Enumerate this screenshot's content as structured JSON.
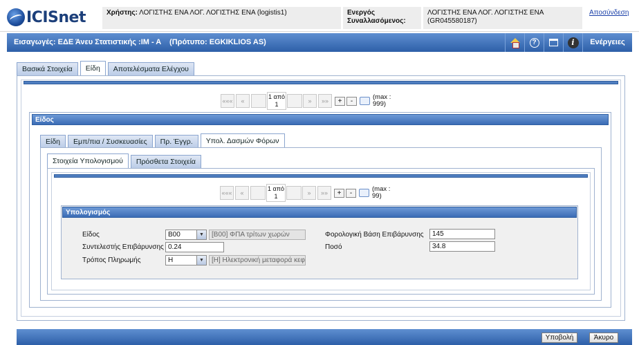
{
  "header": {
    "logo_text": "ICISnet",
    "user_label": "Χρήστης:",
    "user_value": "ΛΟΓΙΣΤΗΣ ΕΝΑ ΛΟΓ. ΛΟΓΙΣΤΗΣ ΕΝΑ (logistis1)",
    "active_label_line1": "Ενεργός",
    "active_label_line2": "Συναλλασόμενος:",
    "active_value_line1": "ΛΟΓΙΣΤΗΣ ΕΝΑ ΛΟΓ. ΛΟΓΙΣΤΗΣ ΕΝΑ",
    "active_value_line2": "(GR045580187)",
    "logout": "Αποσύνδεση"
  },
  "titlebar": {
    "title": "Εισαγωγές: ΕΔΕ Άνευ Στατιστικής :IM - A    (Πρότυπο: EGKIKLIOS AS)",
    "actions_label": "Ενέργειες",
    "icons": [
      "home-icon",
      "help-icon",
      "window-icon",
      "info-icon"
    ]
  },
  "main_tabs": [
    "Βασικά Στοιχεία",
    "Είδη",
    "Αποτελέσματα Ελέγχου"
  ],
  "pager_outer": {
    "first": "«««",
    "prev": "«",
    "count_line1": "1 από",
    "count_line2": "1",
    "next": "»",
    "last": "»»",
    "plus": "+",
    "minus": "-",
    "max_line1": "(max :",
    "max_line2": "999)"
  },
  "item_section": {
    "title": "Είδος",
    "tabs": [
      "Είδη",
      "Εμπ/πια / Συσκευασίες",
      "Πρ. Έγγρ.",
      "Υπολ. Δασμών Φόρων"
    ]
  },
  "calc_tabs": [
    "Στοιχεία Υπολογισμού",
    "Πρόσθετα Στοιχεία"
  ],
  "pager_inner": {
    "first": "«««",
    "prev": "«",
    "count_line1": "1 από",
    "count_line2": "1",
    "next": "»",
    "last": "»»",
    "plus": "+",
    "minus": "-",
    "max_line1": "(max :",
    "max_line2": "99)"
  },
  "calc": {
    "title": "Υπολογισμός",
    "eidos_label": "Είδος",
    "eidos_value": "B00",
    "eidos_desc": "[B00] ΦΠΑ τρίτων χωρών",
    "syntelestis_label": "Συντελεστής Επιβάρυνσης",
    "syntelestis_value": "0.24",
    "tropos_label": "Τρόπος Πληρωμής",
    "tropos_value": "H",
    "tropos_desc": "[H] Ηλεκτρονική μεταφορά κεφαλ",
    "vasi_label": "Φορολογική Βάση Επιβάρυνσης",
    "vasi_value": "145",
    "poso_label": "Ποσό",
    "poso_value": "34.8"
  },
  "footer": {
    "submit": "Υποβολή",
    "cancel": "Άκυρο"
  }
}
